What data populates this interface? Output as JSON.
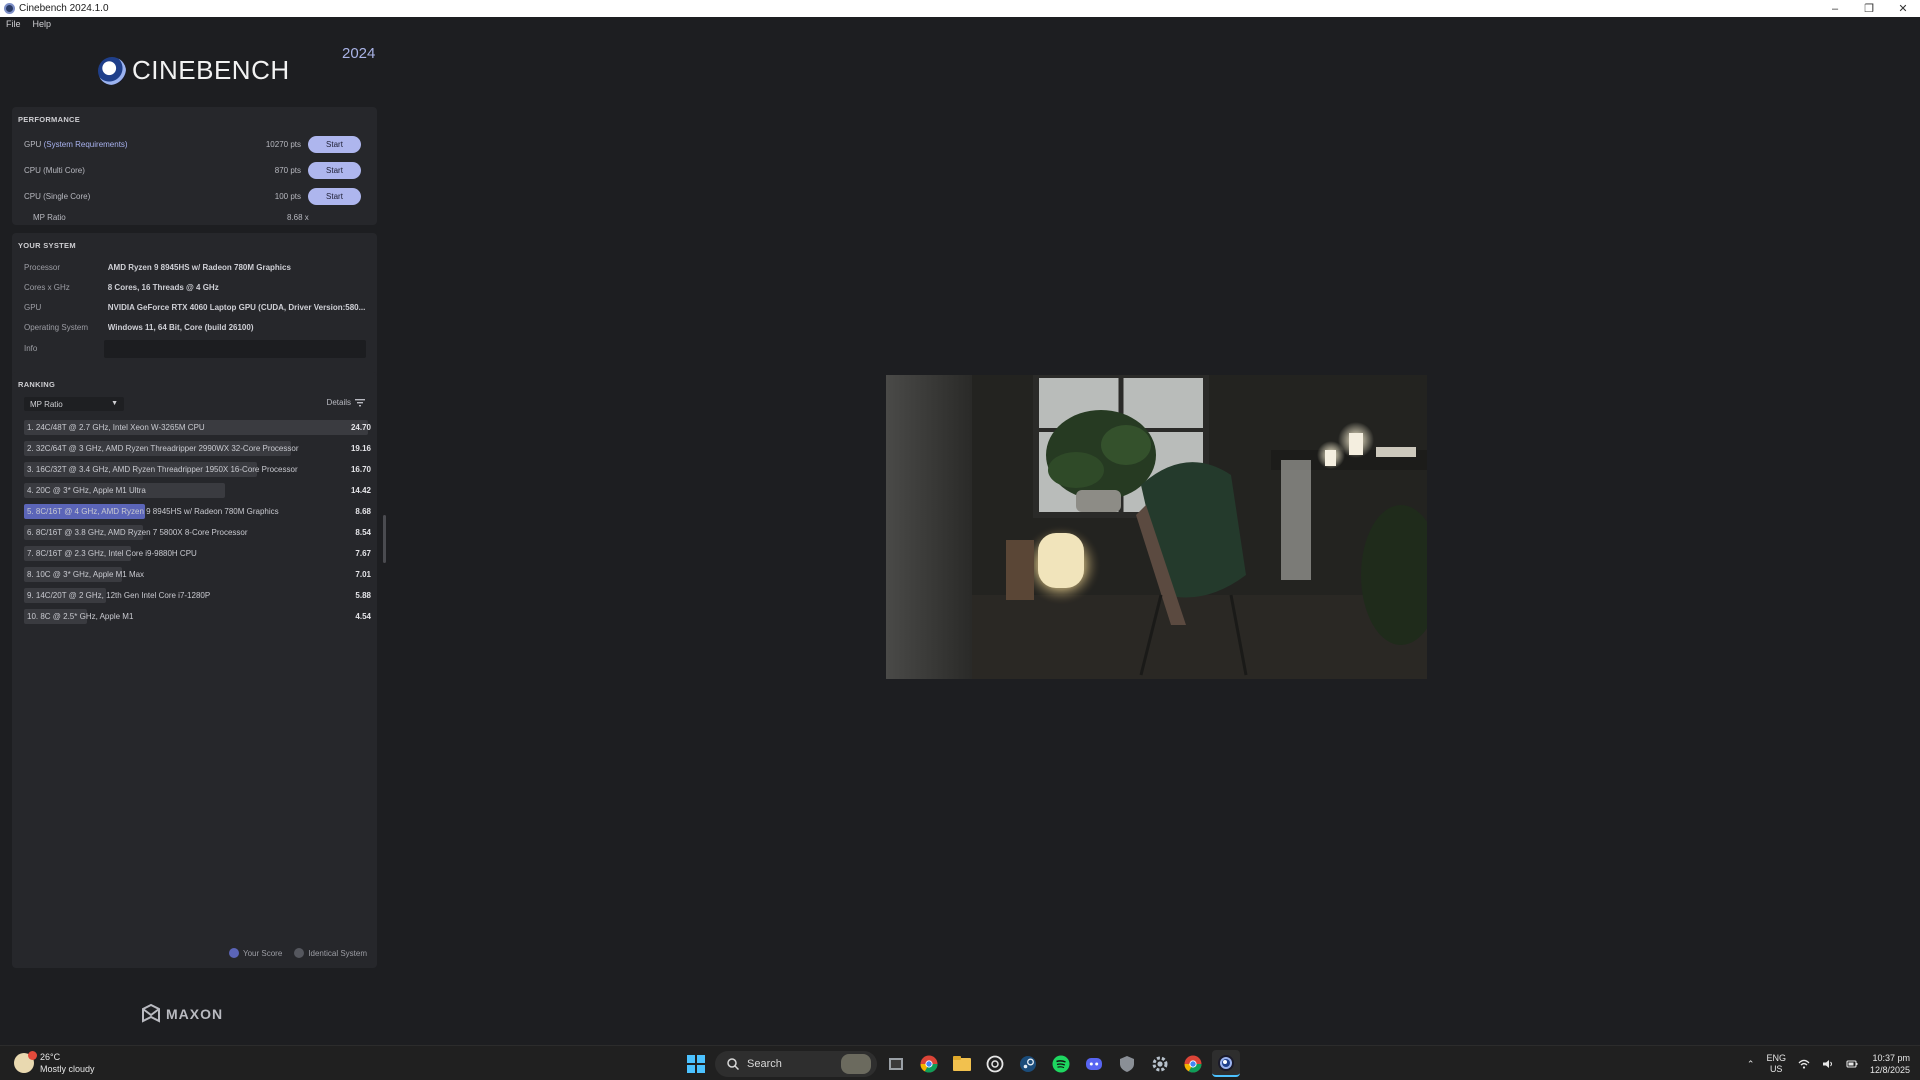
{
  "window": {
    "title": "Cinebench 2024.1.0"
  },
  "menu": [
    "File",
    "Help"
  ],
  "app": {
    "logo_text": "CINEBENCH",
    "year": "2024"
  },
  "performance": {
    "title": "PERFORMANCE",
    "rows": [
      {
        "label": "GPU ",
        "link": "(System Requirements)",
        "pts": "10270 pts",
        "button": "Start"
      },
      {
        "label": "CPU (Multi Core)",
        "pts": "870 pts",
        "button": "Start"
      },
      {
        "label": "CPU (Single Core)",
        "pts": "100 pts",
        "button": "Start"
      }
    ],
    "mp_ratio_label": "MP Ratio",
    "mp_ratio_value": "8.68 x"
  },
  "system": {
    "title": "YOUR SYSTEM",
    "rows": [
      {
        "key": "Processor",
        "value": "AMD Ryzen 9 8945HS w/ Radeon 780M Graphics"
      },
      {
        "key": "Cores x GHz",
        "value": "8 Cores, 16 Threads @ 4 GHz"
      },
      {
        "key": "GPU",
        "value": "NVIDIA GeForce RTX 4060 Laptop GPU (CUDA, Driver Version:580..."
      },
      {
        "key": "Operating System",
        "value": "Windows 11, 64 Bit, Core (build 26100)"
      },
      {
        "key": "Info",
        "value": ""
      }
    ]
  },
  "ranking": {
    "title": "RANKING",
    "selected": "MP Ratio",
    "details_label": "Details",
    "max_score": 24.7,
    "rows": [
      {
        "name": "1. 24C/48T @ 2.7 GHz, Intel Xeon W-3265M CPU",
        "score": "24.70",
        "value": 24.7,
        "mine": false
      },
      {
        "name": "2. 32C/64T @ 3 GHz, AMD Ryzen Threadripper 2990WX 32-Core Processor",
        "score": "19.16",
        "value": 19.16,
        "mine": false
      },
      {
        "name": "3. 16C/32T @ 3.4 GHz, AMD Ryzen Threadripper 1950X 16-Core Processor",
        "score": "16.70",
        "value": 16.7,
        "mine": false
      },
      {
        "name": "4. 20C @ 3* GHz, Apple M1 Ultra",
        "score": "14.42",
        "value": 14.42,
        "mine": false
      },
      {
        "name": "5. 8C/16T @ 4 GHz, AMD Ryzen 9 8945HS w/ Radeon 780M Graphics",
        "score": "8.68",
        "value": 8.68,
        "mine": true
      },
      {
        "name": "6. 8C/16T @ 3.8 GHz, AMD Ryzen 7 5800X 8-Core Processor",
        "score": "8.54",
        "value": 8.54,
        "mine": false
      },
      {
        "name": "7. 8C/16T @ 2.3 GHz, Intel Core i9-9880H CPU",
        "score": "7.67",
        "value": 7.67,
        "mine": false
      },
      {
        "name": "8. 10C @ 3* GHz, Apple M1 Max",
        "score": "7.01",
        "value": 7.01,
        "mine": false
      },
      {
        "name": "9. 14C/20T @ 2 GHz, 12th Gen Intel Core i7-1280P",
        "score": "5.88",
        "value": 5.88,
        "mine": false
      },
      {
        "name": "10. 8C @ 2.5* GHz, Apple M1",
        "score": "4.54",
        "value": 4.54,
        "mine": false
      }
    ],
    "legend": [
      {
        "label": "Your Score",
        "color": "#5b65b8"
      },
      {
        "label": "Identical System",
        "color": "#55575e"
      }
    ]
  },
  "footer": {
    "brand": "MAXON"
  },
  "taskbar": {
    "weather_temp": "26°C",
    "weather_desc": "Mostly cloudy",
    "search_label": "Search",
    "lang_top": "ENG",
    "lang_bottom": "US",
    "time": "10:37 pm",
    "date": "12/8/2025"
  },
  "colors": {
    "accent": "#aeb6ee",
    "your_score": "#5b65b8",
    "panel": "#26272b",
    "background": "#1d1e21"
  }
}
